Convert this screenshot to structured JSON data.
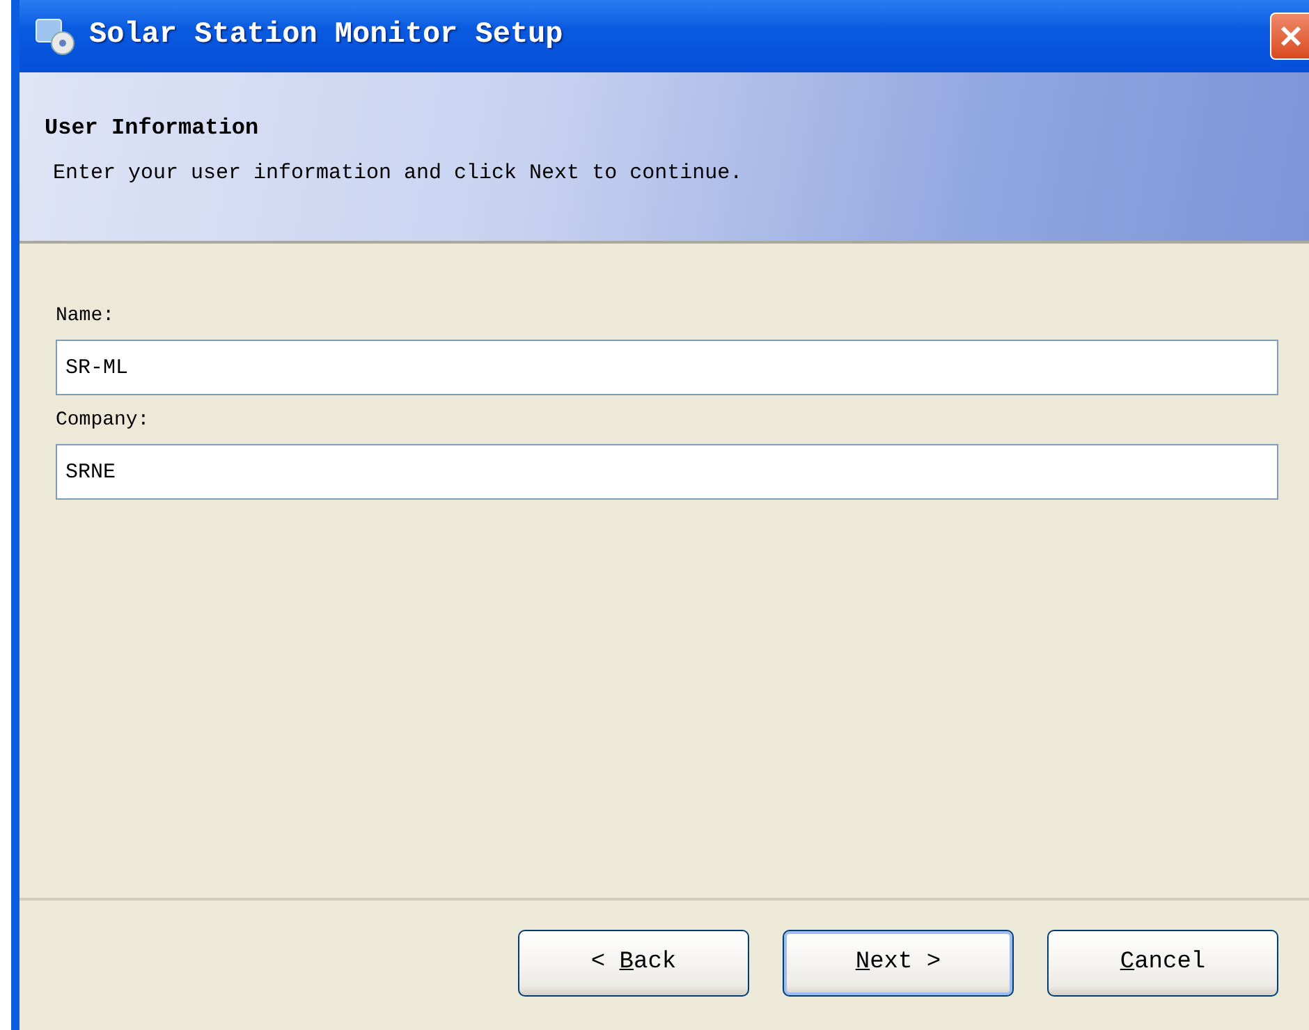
{
  "window": {
    "title": "Solar Station Monitor Setup"
  },
  "header": {
    "title": "User Information",
    "subtitle": "Enter your user information and click Next to continue."
  },
  "fields": [
    {
      "label": "Name:",
      "value": "SR-ML"
    },
    {
      "label": "Company:",
      "value": "SRNE"
    }
  ],
  "buttons": [
    {
      "prefix": "< ",
      "accel": "B",
      "suffix": "ack",
      "default": false
    },
    {
      "accel": "N",
      "suffix": "ext >",
      "default": true
    },
    {
      "accel": "C",
      "suffix": "ancel",
      "default": false
    }
  ]
}
